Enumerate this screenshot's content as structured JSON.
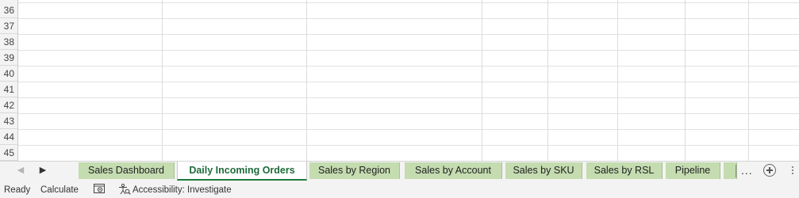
{
  "grid": {
    "row_numbers": [
      "36",
      "37",
      "38",
      "39",
      "40",
      "41",
      "42",
      "43",
      "44",
      "45"
    ]
  },
  "sheet_tabs": {
    "prev_icon": "chevron-left-icon",
    "next_icon": "chevron-right-icon",
    "tabs": [
      {
        "label": "Sales Dashboard",
        "active": false
      },
      {
        "label": "Daily Incoming Orders",
        "active": true
      },
      {
        "label": "Sales by Region",
        "active": false
      },
      {
        "label": "Sales by Account",
        "active": false
      },
      {
        "label": "Sales by SKU",
        "active": false
      },
      {
        "label": "Sales by RSL",
        "active": false
      },
      {
        "label": "Pipeline",
        "active": false
      }
    ],
    "more_label": "...",
    "add_icon": "plus-circle-icon",
    "tab_color": "#c4dcb0",
    "active_color": "#1e6b3a"
  },
  "status_bar": {
    "ready": "Ready",
    "calculate": "Calculate",
    "macro_icon": "macro-recorder-icon",
    "accessibility_icon": "accessibility-icon",
    "accessibility": "Accessibility: Investigate"
  }
}
